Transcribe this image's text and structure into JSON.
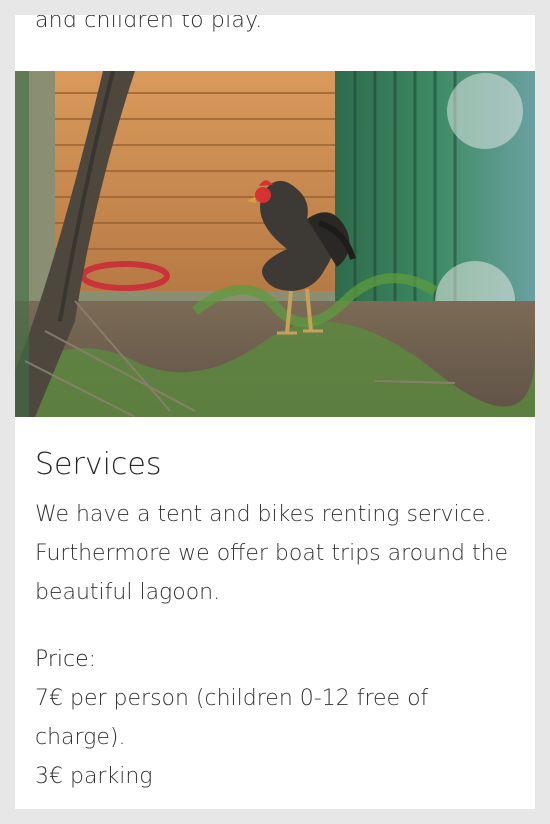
{
  "intro": {
    "tail_text": "and children to play."
  },
  "photo": {
    "subject_icon": "rooster-photo"
  },
  "services": {
    "title": "Services",
    "description": "We have a tent and bikes renting service. Furthermore we offer boat trips around the beautiful lagoon.",
    "price_label": "Price:",
    "price_lines": [
      "7€ per person (children 0-12 free of charge).",
      "3€ parking"
    ]
  },
  "colors": {
    "page_background": "#e7e7e7",
    "card_background": "#ffffff",
    "text": "#333333"
  }
}
